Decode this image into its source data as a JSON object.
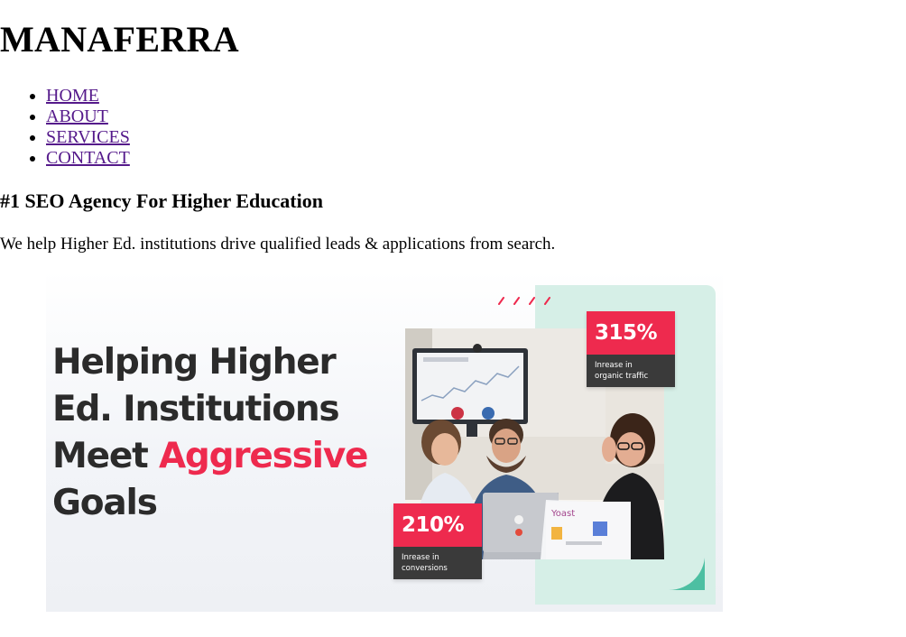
{
  "site": {
    "title": "MANAFERRA"
  },
  "nav": {
    "items": [
      {
        "label": "HOME"
      },
      {
        "label": "ABOUT"
      },
      {
        "label": "SERVICES"
      },
      {
        "label": "CONTACT"
      }
    ]
  },
  "main": {
    "headline": "#1 SEO Agency For Higher Education",
    "subline": "We help Higher Ed. institutions drive qualified leads & applications from search."
  },
  "hero": {
    "line1": "Helping Higher",
    "line2": "Ed. Institutions",
    "line3_start": "Meet ",
    "line3_accent": "Aggressive",
    "line4": "Goals",
    "stats": [
      {
        "value": "315%",
        "caption_line1": "Inrease in",
        "caption_line2": "organic traffic"
      },
      {
        "value": "210%",
        "caption_line1": "Inrease in",
        "caption_line2": "conversions"
      }
    ],
    "laptop_brand_text": "Yoast",
    "accent_color": "#ee2a4e",
    "panel_color": "#d6efe7",
    "shape_color": "#4dbfa2"
  }
}
